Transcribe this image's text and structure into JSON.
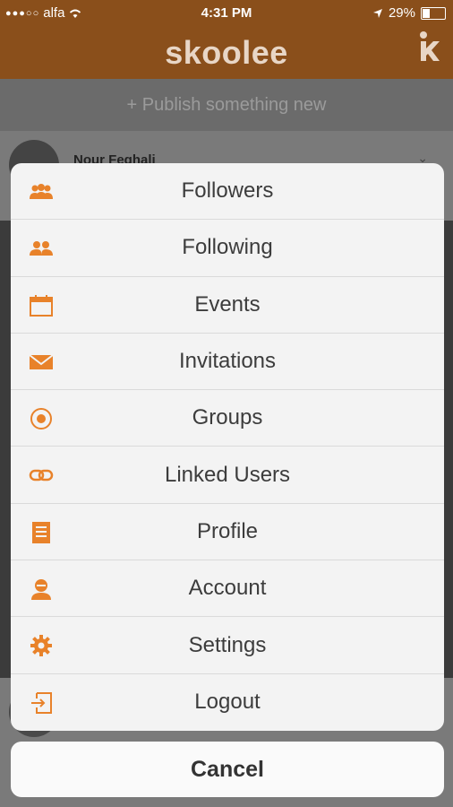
{
  "status_bar": {
    "carrier": "alfa",
    "time": "4:31 PM",
    "battery_pct": "29%",
    "battery_level": 0.29
  },
  "header": {
    "brand": "skoolee"
  },
  "publish": {
    "label": "+ Publish something new"
  },
  "post": {
    "author": "Nour Feghali"
  },
  "menu": {
    "items": [
      {
        "label": "Followers",
        "icon": "followers-icon"
      },
      {
        "label": "Following",
        "icon": "following-icon"
      },
      {
        "label": "Events",
        "icon": "calendar-icon"
      },
      {
        "label": "Invitations",
        "icon": "envelope-icon"
      },
      {
        "label": "Groups",
        "icon": "groups-icon"
      },
      {
        "label": "Linked Users",
        "icon": "link-icon"
      },
      {
        "label": "Profile",
        "icon": "profile-icon"
      },
      {
        "label": "Account",
        "icon": "account-icon"
      },
      {
        "label": "Settings",
        "icon": "gear-icon"
      },
      {
        "label": "Logout",
        "icon": "logout-icon"
      }
    ],
    "cancel_label": "Cancel"
  },
  "colors": {
    "accent": "#e8822a",
    "header": "#8a4f1b"
  }
}
